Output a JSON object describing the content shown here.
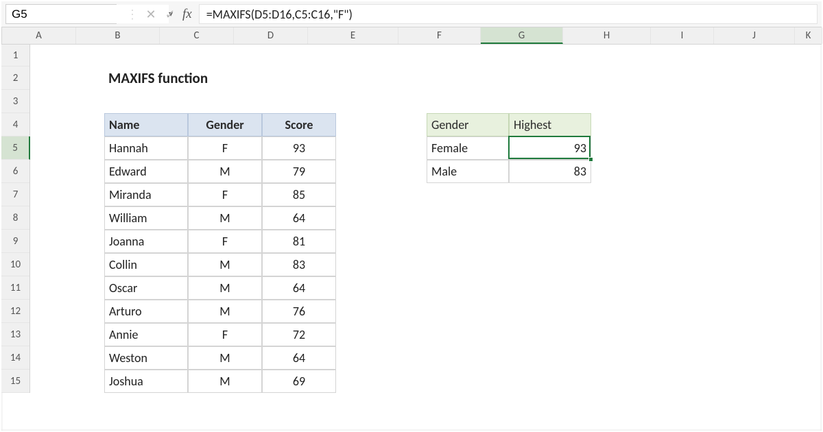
{
  "active_cell": "G5",
  "formula": "=MAXIFS(D5:D16,C5:C16,\"F\")",
  "columns": [
    "A",
    "B",
    "C",
    "D",
    "E",
    "F",
    "G",
    "H",
    "I",
    "J",
    "K"
  ],
  "col_widths": {
    "A": 108,
    "B": 122,
    "C": 108,
    "D": 108,
    "E": 132,
    "F": 120,
    "G": 120,
    "H": 128,
    "I": 92,
    "J": 118,
    "K": 40
  },
  "rows": [
    1,
    2,
    3,
    4,
    5,
    6,
    7,
    8,
    9,
    10,
    11,
    12,
    13,
    14,
    15
  ],
  "selected_col": "G",
  "selected_row": 5,
  "title": "MAXIFS function",
  "table1": {
    "header": {
      "name": "Name",
      "gender": "Gender",
      "score": "Score"
    },
    "rows": [
      {
        "name": "Hannah",
        "gender": "F",
        "score": 93
      },
      {
        "name": "Edward",
        "gender": "M",
        "score": 79
      },
      {
        "name": "Miranda",
        "gender": "F",
        "score": 85
      },
      {
        "name": "William",
        "gender": "M",
        "score": 64
      },
      {
        "name": "Joanna",
        "gender": "F",
        "score": 81
      },
      {
        "name": "Collin",
        "gender": "M",
        "score": 83
      },
      {
        "name": "Oscar",
        "gender": "M",
        "score": 64
      },
      {
        "name": "Arturo",
        "gender": "M",
        "score": 76
      },
      {
        "name": "Annie",
        "gender": "F",
        "score": 72
      },
      {
        "name": "Weston",
        "gender": "M",
        "score": 64
      },
      {
        "name": "Joshua",
        "gender": "M",
        "score": 69
      }
    ]
  },
  "table2": {
    "header": {
      "gender": "Gender",
      "highest": "Highest"
    },
    "rows": [
      {
        "gender": "Female",
        "highest": 93
      },
      {
        "gender": "Male",
        "highest": 83
      }
    ]
  }
}
